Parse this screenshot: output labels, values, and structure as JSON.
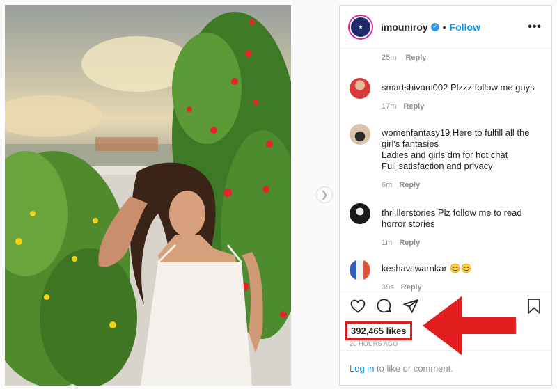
{
  "post": {
    "username": "imouniroy",
    "verified_icon": "verified-check-icon",
    "separator": "•",
    "follow_label": "Follow",
    "more_label": "•••"
  },
  "comments": {
    "previous_time": "25m",
    "previous_reply": "Reply",
    "items": [
      {
        "user": "smartshivam002",
        "text": "Plzzz follow me guys",
        "time": "17m",
        "reply": "Reply",
        "avatar_color": "#d83a3a"
      },
      {
        "user": "womenfantasy19",
        "text": "Here to fulfill all the girl's fantasies\nLadies and girls dm for hot chat\nFull satisfaction and privacy",
        "time": "6m",
        "reply": "Reply",
        "avatar_color": "#c9b8a6"
      },
      {
        "user": "thri.llerstories",
        "text": "Plz follow me to read horror stories",
        "time": "1m",
        "reply": "Reply",
        "avatar_color": "#1a1a1a"
      },
      {
        "user": "keshavswarnkar",
        "text": "😊😊",
        "time": "39s",
        "reply": "Reply",
        "avatar_color": "#e0533f"
      }
    ]
  },
  "actions": {
    "like_icon": "heart-icon",
    "comment_icon": "comment-bubble-icon",
    "share_icon": "paper-plane-icon",
    "save_icon": "bookmark-icon"
  },
  "likes_text": "392,465 likes",
  "time_ago": "20 HOURS AGO",
  "login": {
    "link": "Log in",
    "suffix": " to like or comment."
  },
  "colors": {
    "accent": "#0095f6",
    "highlight": "#e11d1d"
  }
}
